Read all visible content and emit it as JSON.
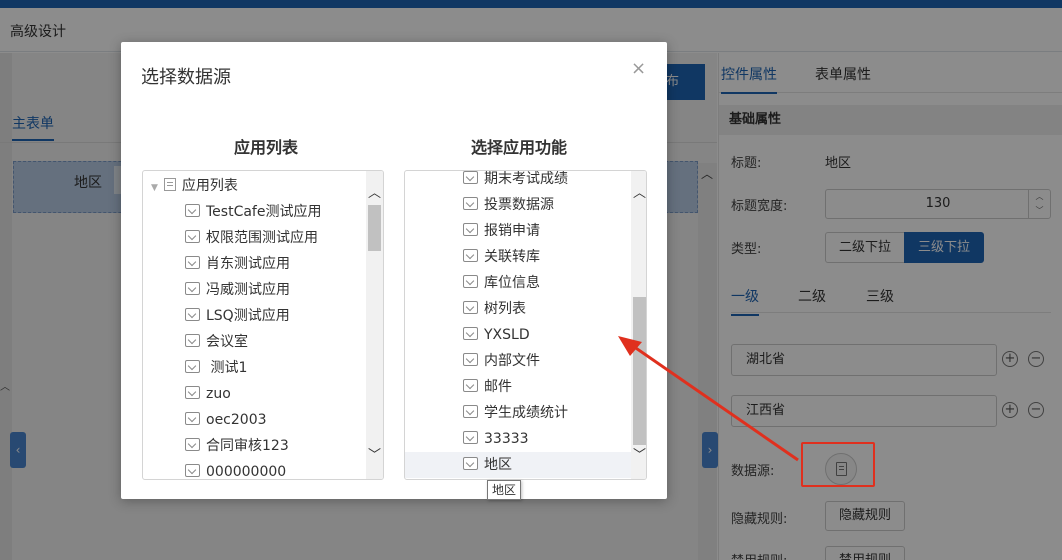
{
  "header": {
    "title": "高级设计"
  },
  "canvas": {
    "main_tab": "主表单",
    "field_label": "地区",
    "publish_btn": "布"
  },
  "properties": {
    "tabs": [
      "控件属性",
      "表单属性"
    ],
    "section": "基础属性",
    "title_label": "标题:",
    "title_value": "地区",
    "width_label": "标题宽度:",
    "width_value": "130",
    "type_label": "类型:",
    "type_options": [
      "二级下拉",
      "三级下拉"
    ],
    "type_selected": "三级下拉",
    "level_tabs": [
      "一级",
      "二级",
      "三级"
    ],
    "provinces": [
      "湖北省",
      "江西省"
    ],
    "datasource_label": "数据源:",
    "hide_rule_label": "隐藏规则:",
    "hide_rule_btn": "隐藏规则",
    "disable_rule_label": "禁用规则:",
    "disable_rule_btn": "禁用规则"
  },
  "modal": {
    "title": "选择数据源",
    "close": "×",
    "left_title": "应用列表",
    "right_title": "选择应用功能",
    "app_list_root": "应用列表",
    "apps": [
      "TestCafe测试应用",
      "权限范围测试应用",
      "肖东测试应用",
      "冯威测试应用",
      "LSQ测试应用",
      "会议室",
      " 测试1",
      "zuo",
      "oec2003",
      "合同审核123",
      "000000000"
    ],
    "functions": [
      "期末考试成绩",
      "投票数据源",
      "报销申请",
      "关联转库",
      "库位信息",
      "树列表",
      "YXSLD",
      "内部文件",
      "邮件",
      "学生成绩统计",
      "33333",
      "地区"
    ],
    "selected_function": "地区",
    "tooltip": "地区"
  },
  "colors": {
    "accent": "#1e64b4",
    "annotation": "#e0301e"
  }
}
